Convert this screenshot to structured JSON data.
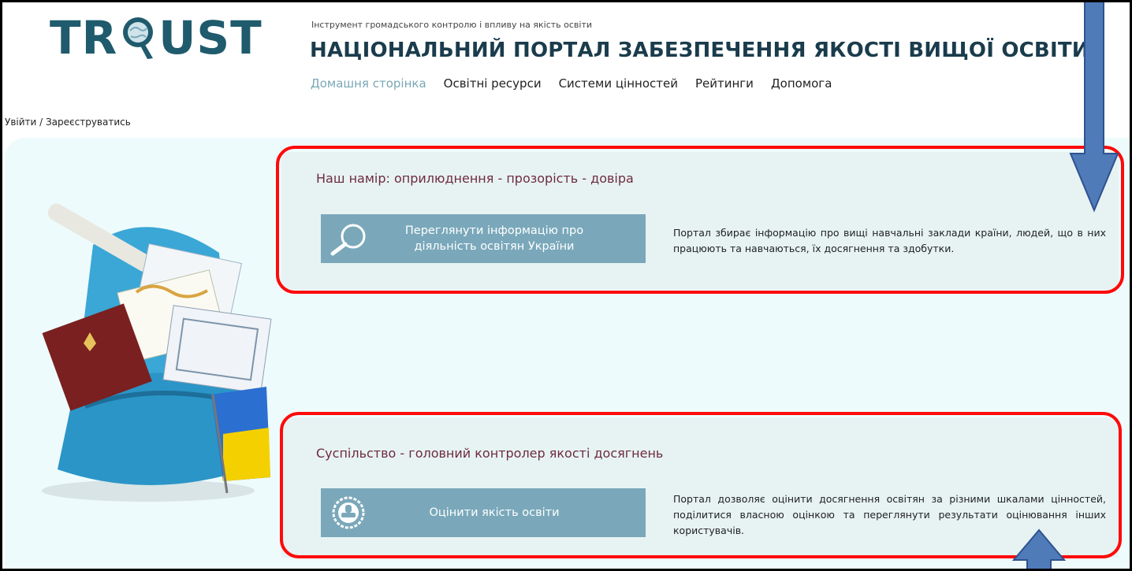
{
  "header": {
    "logo": {
      "text_left": "TR",
      "text_right": "UST"
    },
    "tagline": "Інструмент громадського контролю і впливу на якість освіти",
    "title": "НАЦІОНАЛЬНИЙ ПОРТАЛ ЗАБЕЗПЕЧЕННЯ ЯКОСТІ ВИЩОЇ ОСВІТИ",
    "nav": [
      {
        "label": "Домашня сторінка",
        "active": true
      },
      {
        "label": "Освітні ресурси",
        "active": false
      },
      {
        "label": "Системи цінностей",
        "active": false
      },
      {
        "label": "Рейтинги",
        "active": false
      },
      {
        "label": "Допомога",
        "active": false
      }
    ],
    "auth": {
      "login": "Увійти",
      "separator": " / ",
      "register": "Зареєструватись"
    }
  },
  "cards": [
    {
      "title": "Наш намір: оприлюднення - прозорість - довіра",
      "button_label": "Переглянути інформацію про діяльність освітян України",
      "button_icon": "magnifier-icon",
      "description": "Портал збирає інформацію про вищі навчальні заклади країни, людей, що в них працюють та навчаються, їх досягнення та здобутки."
    },
    {
      "title": "Суспільство - головний контролер якості досягнень",
      "button_label": "Оцінити якість освіти",
      "button_icon": "stamp-icon",
      "description": "Портал дозволяє оцінити досягнення освітян за різними шкалами цінностей, поділитися власною оцінкою та переглянути результати оцінювання інших користувачів."
    }
  ],
  "colors": {
    "brand": "#1f5b6d",
    "accent": "#7aa8ba",
    "card_title": "#6e2b3e",
    "highlight": "#ff0a0a",
    "arrow_fill": "#4f7bb8",
    "arrow_stroke": "#2f528f"
  }
}
